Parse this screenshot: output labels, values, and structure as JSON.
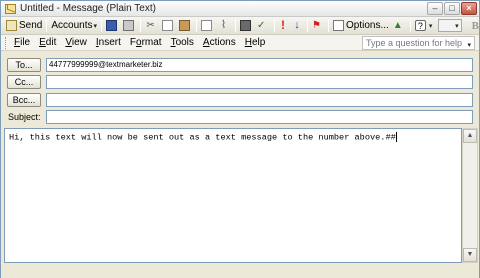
{
  "window": {
    "title": "Untitled - Message (Plain Text)",
    "controls": {
      "minimize": "–",
      "restore": "□",
      "close": "×"
    }
  },
  "toolbar": {
    "send_label": "Send",
    "accounts_label": "Accounts",
    "options_label": "Options...",
    "help_glyph": "?",
    "bold_label": "B",
    "exclamation_glyph": "!",
    "down_glyph": "↓",
    "dropdown_glyph": "▾",
    "check_glyph": "✓",
    "cut_glyph": "✂",
    "clip_glyph": "⌇",
    "flag_glyph": "⚑",
    "tri_glyph": "▲"
  },
  "menu": {
    "items": [
      "File",
      "Edit",
      "View",
      "Insert",
      "Format",
      "Tools",
      "Actions",
      "Help"
    ],
    "accel": [
      "F",
      "E",
      "V",
      "I",
      "o",
      "T",
      "A",
      "H"
    ],
    "help_placeholder": "Type a question for help"
  },
  "header": {
    "to_label": "To...",
    "cc_label": "Cc...",
    "bcc_label": "Bcc...",
    "subject_label": "Subject:",
    "to_value": "44777999999@textmarketer.biz",
    "cc_value": "",
    "bcc_value": "",
    "subject_value": ""
  },
  "body": {
    "text": "Hi, this text will now be sent out as a text message to the number above.##"
  },
  "scrollbar": {
    "up": "▲",
    "down": "▼"
  }
}
